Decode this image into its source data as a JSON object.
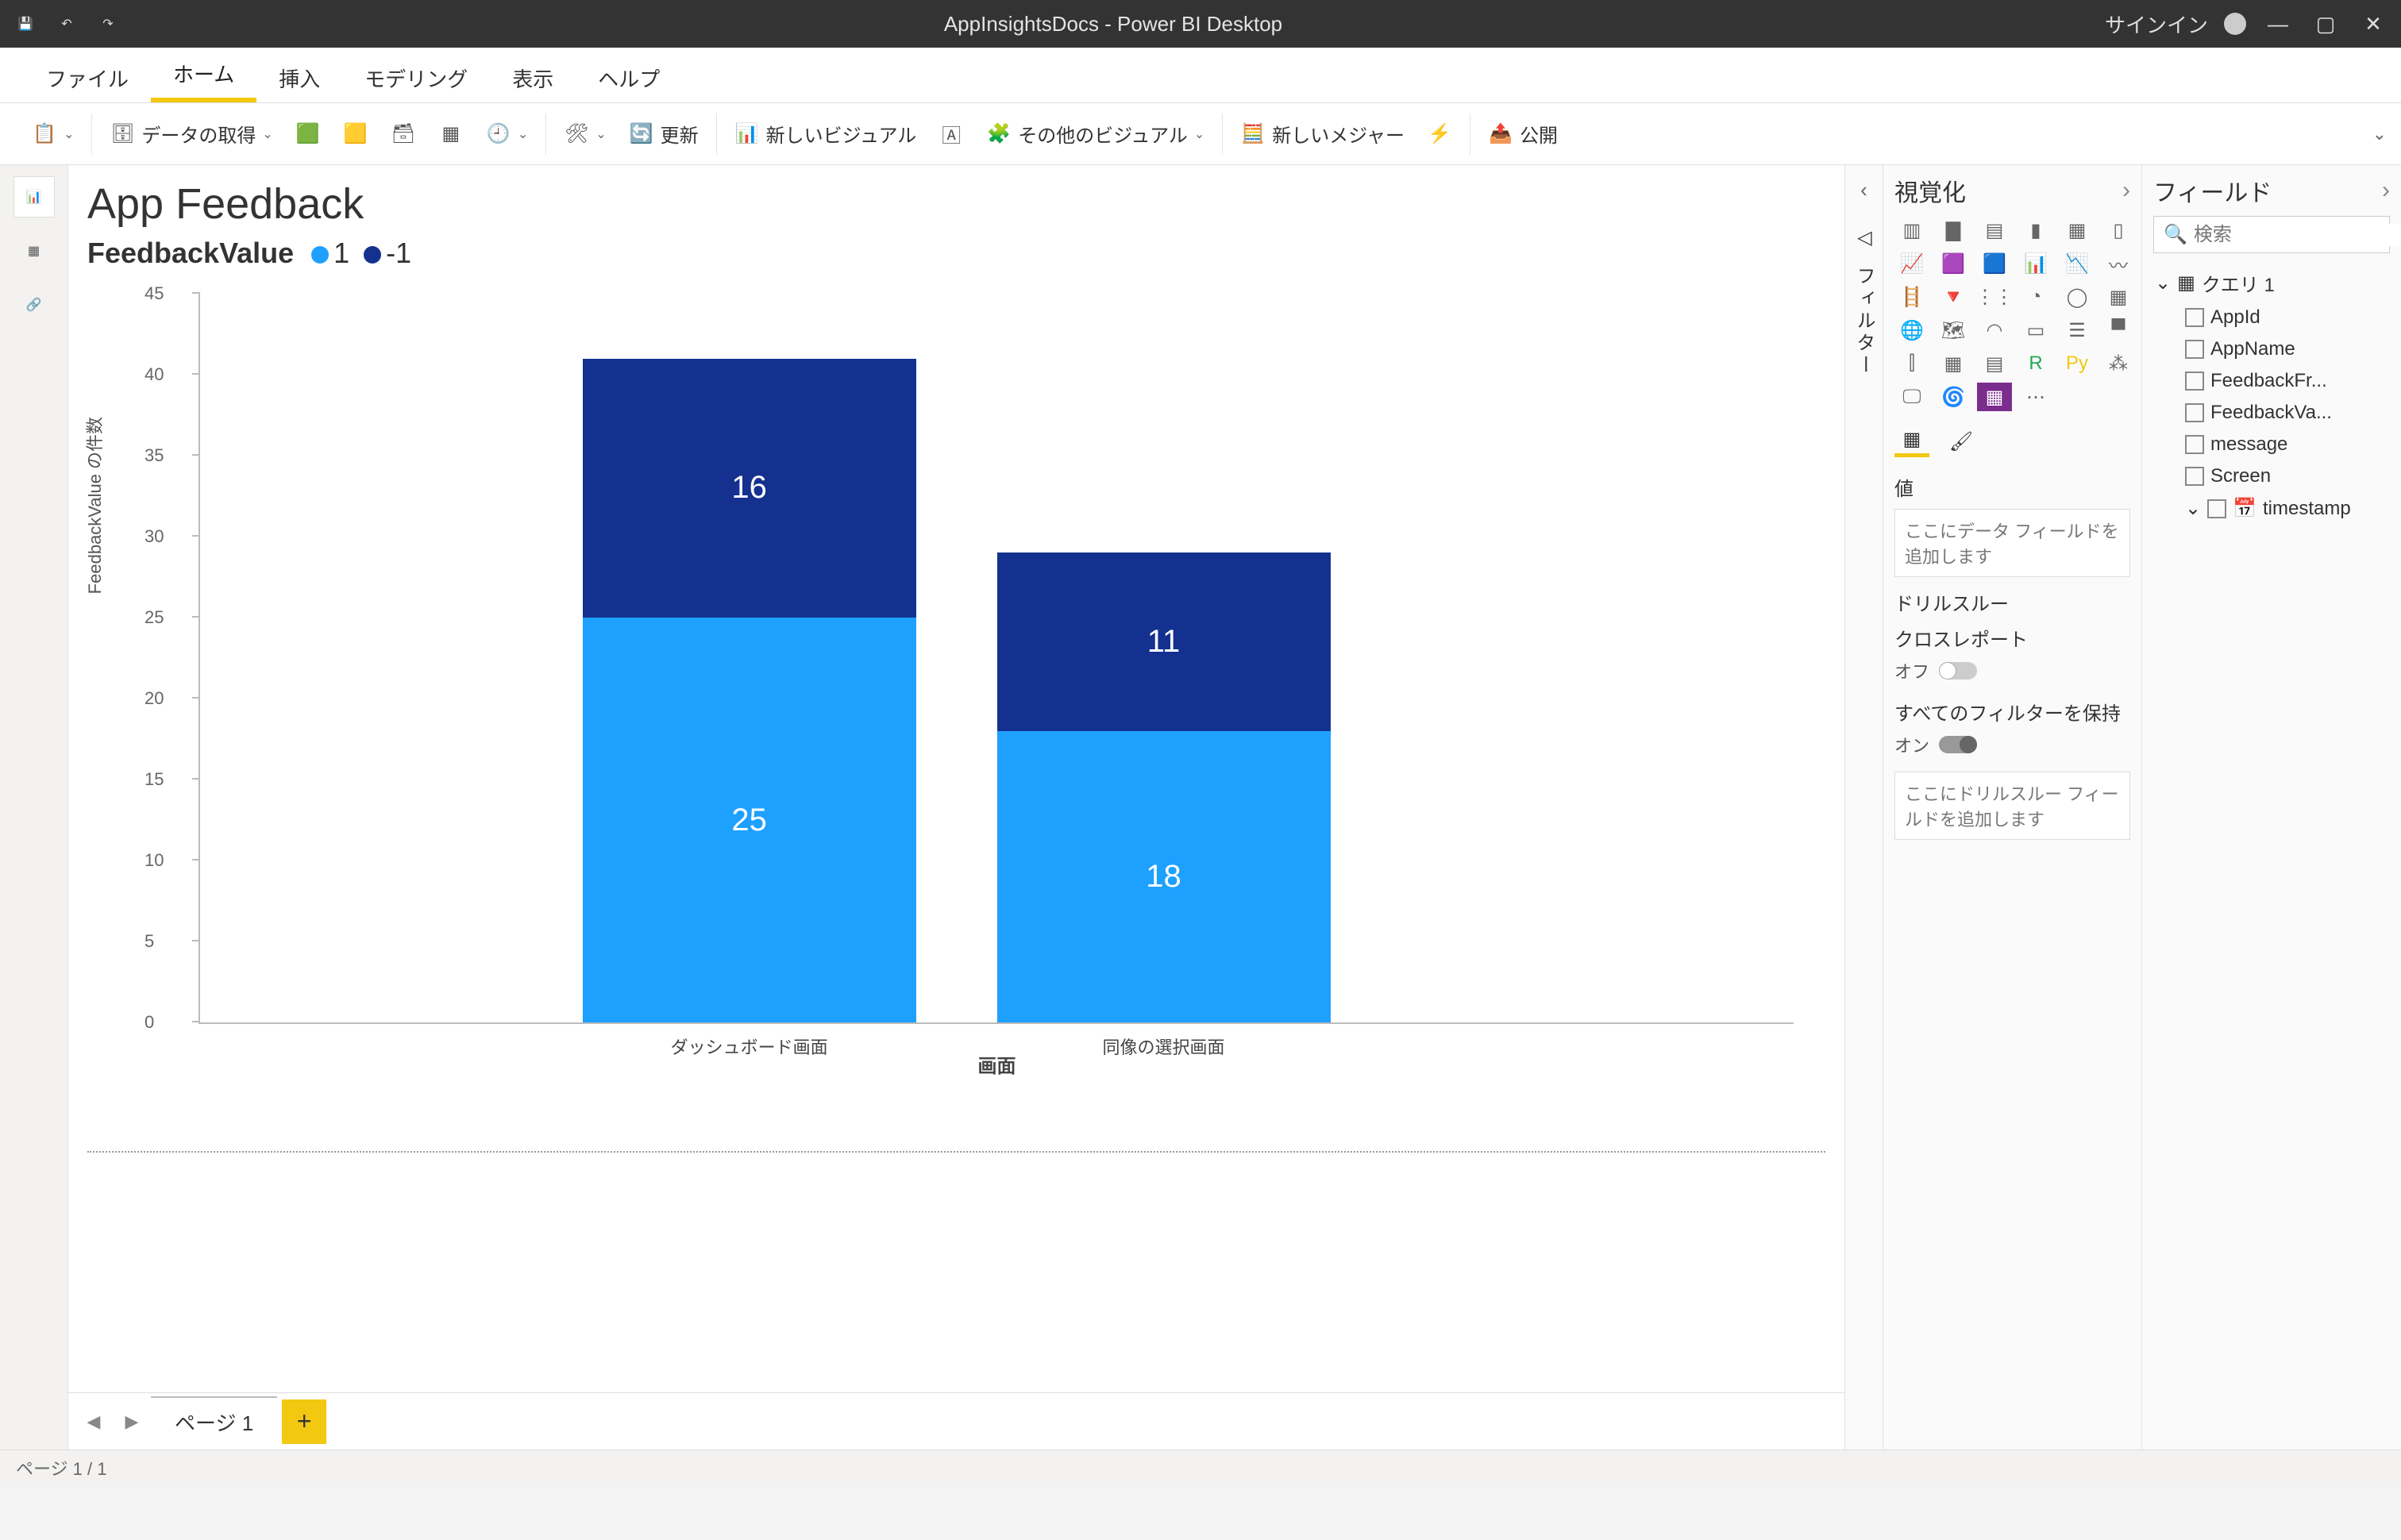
{
  "titlebar": {
    "app_title": "AppInsightsDocs - Power BI Desktop",
    "signin": "サインイン"
  },
  "menubar": {
    "items": [
      "ファイル",
      "ホーム",
      "挿入",
      "モデリング",
      "表示",
      "ヘルプ"
    ],
    "active_index": 1
  },
  "ribbon": {
    "get_data": "データの取得",
    "refresh": "更新",
    "new_visual": "新しいビジュアル",
    "more_visuals": "その他のビジュアル",
    "new_measure": "新しいメジャー",
    "publish": "公開"
  },
  "filter_pane_label": "フィルター",
  "viz_panel": {
    "title": "視覚化",
    "values_label": "値",
    "values_placeholder": "ここにデータ フィールドを追加します",
    "drillthrough_label": "ドリルスルー",
    "cross_report_label": "クロスレポート",
    "cross_report_state": "オフ",
    "keep_filters_label": "すべてのフィルターを保持",
    "keep_filters_state": "オン",
    "drill_placeholder": "ここにドリルスルー フィールドを追加します"
  },
  "fields_panel": {
    "title": "フィールド",
    "search_placeholder": "検索",
    "table": "クエリ 1",
    "columns": [
      "AppId",
      "AppName",
      "FeedbackFr...",
      "FeedbackVa...",
      "message",
      "Screen"
    ],
    "hier": "timestamp"
  },
  "page_tabs": {
    "page1": "ページ 1"
  },
  "status_bar": "ページ 1 / 1",
  "chart_data": {
    "type": "bar",
    "stacked": true,
    "title": "App Feedback",
    "legend_field": "FeedbackValue",
    "series": [
      {
        "name": "1",
        "color": "#1ea0ff",
        "values": [
          25,
          18
        ]
      },
      {
        "name": "-1",
        "color": "#14318f",
        "values": [
          16,
          11
        ]
      }
    ],
    "categories": [
      "ダッシュボード画面",
      "同像の選択画面"
    ],
    "xlabel": "画面",
    "ylabel": "FeedbackValue の件数",
    "yticks": [
      0,
      5,
      10,
      15,
      20,
      25,
      30,
      35,
      40,
      45
    ],
    "ylim": [
      0,
      45
    ]
  }
}
